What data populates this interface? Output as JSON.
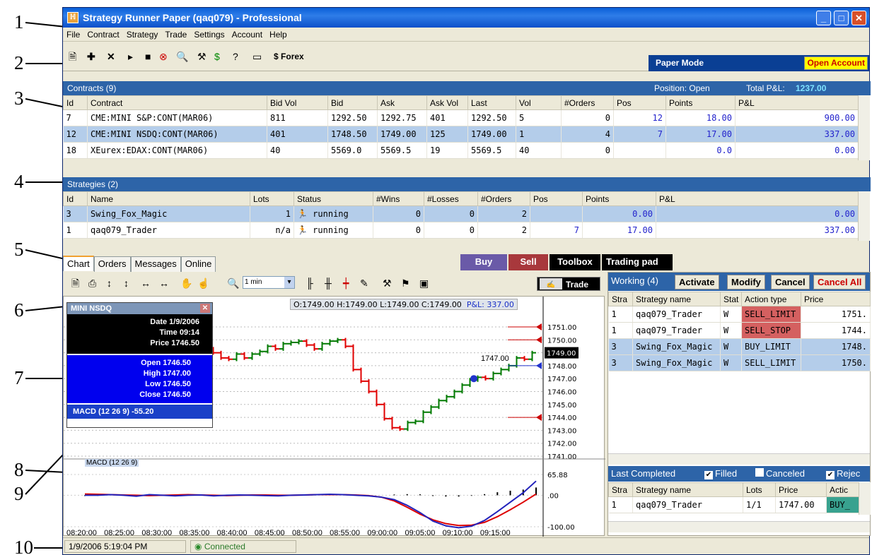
{
  "callouts": [
    "1",
    "2",
    "3",
    "4",
    "5",
    "6",
    "7",
    "8",
    "9",
    "10"
  ],
  "window": {
    "title": "Strategy Runner Paper (qaq079) - Professional",
    "min": "_",
    "max": "□",
    "close": "✕"
  },
  "menu": [
    "File",
    "Contract",
    "Strategy",
    "Trade",
    "Settings",
    "Account",
    "Help"
  ],
  "toolbar": {
    "forex_label": "Forex",
    "paper_mode": "Paper Mode",
    "open_account": "Open Account"
  },
  "contracts": {
    "title": "Contracts (9)",
    "position_label": "Position: Open",
    "total_pl_label": "Total P&L:",
    "total_pl_value": "1237.00",
    "columns": [
      "Id",
      "Contract",
      "Bid Vol",
      "Bid",
      "Ask",
      "Ask Vol",
      "Last",
      "Vol",
      "#Orders",
      "Pos",
      "Points",
      "P&L"
    ],
    "rows": [
      [
        "7",
        "CME:MINI S&P:CONT(MAR06)",
        "811",
        "1292.50",
        "1292.75",
        "401",
        "1292.50",
        "5",
        "0",
        "12",
        "18.00",
        "900.00"
      ],
      [
        "12",
        "CME:MINI NSDQ:CONT(MAR06)",
        "401",
        "1748.50",
        "1749.00",
        "125",
        "1749.00",
        "1",
        "4",
        "7",
        "17.00",
        "337.00"
      ],
      [
        "18",
        "XEurex:EDAX:CONT(MAR06)",
        "40",
        "5569.0",
        "5569.5",
        "19",
        "5569.5",
        "40",
        "0",
        "",
        "0.0",
        "0.00"
      ]
    ]
  },
  "strategies": {
    "title": "Strategies (2)",
    "columns": [
      "Id",
      "Name",
      "Lots",
      "Status",
      "#Wins",
      "#Losses",
      "#Orders",
      "Pos",
      "Points",
      "P&L"
    ],
    "rows": [
      [
        "3",
        "Swing_Fox_Magic",
        "1",
        "running",
        "0",
        "0",
        "2",
        "",
        "0.00",
        "0.00"
      ],
      [
        "1",
        "qaq079_Trader",
        "n/a",
        "running",
        "0",
        "0",
        "2",
        "7",
        "17.00",
        "337.00"
      ]
    ]
  },
  "tabs": [
    "Chart",
    "Orders",
    "Messages",
    "Online"
  ],
  "actions": {
    "buy": "Buy",
    "sell": "Sell",
    "toolbox": "Toolbox",
    "trading_pad": "Trading pad",
    "trade": "Trade"
  },
  "chart_toolbar": {
    "interval": "1 min"
  },
  "chart": {
    "ohlc": "O:1749.00  H:1749.00  L:1749.00  C:1749.00",
    "pl": "P&L: 337.00",
    "info": {
      "title": "MINI NSDQ",
      "date": "Date 1/9/2006",
      "time": "Time 09:14",
      "price": "Price 1746.50",
      "open": "Open 1746.50",
      "high": "High 1747.00",
      "low": "Low 1746.50",
      "close": "Close 1746.50",
      "macd": "MACD (12 26 9)  -55.20"
    },
    "marker_label": "1747.00",
    "macd_label": "MACD (12 26 9)"
  },
  "chart_data": {
    "type": "line",
    "y_ticks": [
      "1751.00",
      "1750.00",
      "1749.00",
      "1748.00",
      "1747.00",
      "1746.00",
      "1745.00",
      "1744.00",
      "1743.00",
      "1742.00",
      "1741.00"
    ],
    "ylim": [
      1741,
      1751.6
    ],
    "current_price": "1749.00",
    "x_ticks": [
      "08:20:00",
      "08:25:00",
      "08:30:00",
      "08:35:00",
      "08:40:00",
      "08:45:00",
      "08:50:00",
      "08:55:00",
      "09:00:00",
      "09:05:00",
      "09:10:00",
      "09:15:00"
    ],
    "close_series": [
      1749.3,
      1749.6,
      1749.8,
      1749.7,
      1749.9,
      1749.7,
      1749.6,
      1749.5,
      1749.8,
      1749.5,
      1749.7,
      1749.9,
      1750.0,
      1749.7,
      1749.5,
      1749.3,
      1749.0,
      1748.6,
      1748.5,
      1748.9,
      1748.6,
      1748.9,
      1749.1,
      1749.5,
      1749.3,
      1749.7,
      1749.8,
      1749.9,
      1749.6,
      1749.3,
      1749.7,
      1749.9,
      1750.0,
      1749.5,
      1747.7,
      1746.8,
      1746.0,
      1745.0,
      1743.9,
      1743.2,
      1743.1,
      1743.6,
      1743.7,
      1744.4,
      1744.8,
      1745.3,
      1745.6,
      1746.0,
      1746.5,
      1746.9,
      1747.1,
      1747.0,
      1747.4,
      1747.7,
      1748.0,
      1748.6,
      1748.5,
      1749.0
    ],
    "macd_ticks": [
      "65.88",
      ".00",
      "-100.00"
    ],
    "macd_line": [
      0,
      0,
      2,
      0,
      -3,
      2,
      0,
      -2,
      0,
      1,
      -2,
      0,
      1,
      0,
      -1,
      -2,
      0,
      1,
      2,
      3,
      2,
      0,
      -2,
      -6,
      -14,
      -32,
      -55,
      -82,
      -97,
      -103,
      -98,
      -80,
      -52,
      -22,
      8,
      45
    ],
    "signal_line": [
      4,
      3,
      2,
      1,
      0,
      -1,
      0,
      1,
      2,
      1,
      0,
      -1,
      0,
      1,
      1,
      0,
      0,
      1,
      2,
      2,
      2,
      1,
      -1,
      -6,
      -18,
      -38,
      -60,
      -78,
      -90,
      -96,
      -95,
      -86,
      -68,
      -46,
      -22,
      4
    ]
  },
  "working": {
    "title": "Working (4)",
    "buttons": [
      "Activate",
      "Modify",
      "Cancel",
      "Cancel All"
    ],
    "columns": [
      "Stra",
      "Strategy name",
      "Stat",
      "Action type",
      "Price"
    ],
    "rows": [
      [
        "1",
        "qaq079_Trader",
        "W",
        "SELL_LIMIT",
        "1751."
      ],
      [
        "1",
        "qaq079_Trader",
        "W",
        "SELL_STOP",
        "1744."
      ],
      [
        "3",
        "Swing_Fox_Magic",
        "W",
        "BUY_LIMIT",
        "1748."
      ],
      [
        "3",
        "Swing_Fox_Magic",
        "W",
        "SELL_LIMIT",
        "1750."
      ]
    ]
  },
  "completed": {
    "title": "Last Completed",
    "filters": [
      "Filled",
      "Canceled",
      "Rejec"
    ],
    "columns": [
      "Stra",
      "Strategy name",
      "Lots",
      "Price",
      "Actic"
    ],
    "rows": [
      [
        "1",
        "qaq079_Trader",
        "1/1",
        "1747.00",
        "BUY_"
      ]
    ]
  },
  "status": {
    "datetime": "1/9/2006 5:19:04 PM",
    "connection": "Connected"
  },
  "colors": {
    "header_blue": "#2d64a8",
    "buy": "#6a5aa8",
    "sell": "#a8383c",
    "bar_green": "#007a00",
    "bar_red": "#e00000"
  }
}
